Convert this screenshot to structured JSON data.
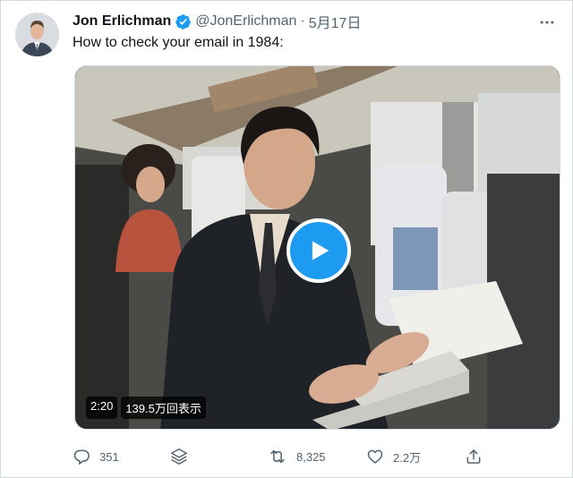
{
  "author": {
    "name": "Jon Erlichman",
    "handle": "@JonErlichman",
    "separator": "·",
    "date": "5月17日"
  },
  "tweet": {
    "text": "How to check your email in 1984:"
  },
  "video": {
    "duration": "2:20",
    "views": "139.5万回表示"
  },
  "actions": {
    "reply_count": "351",
    "retweet_count": "8,325",
    "like_count": "2.2万"
  },
  "icons": {
    "verified": "verified-badge-icon",
    "more": "more-icon",
    "play": "play-icon",
    "reply": "reply-icon",
    "layers": "layers-icon",
    "retweet": "retweet-icon",
    "like": "heart-icon",
    "share": "share-icon"
  },
  "colors": {
    "accent": "#1d9bf0",
    "secondary_text": "#536471",
    "text": "#0f1419",
    "border": "#cfd9de"
  }
}
